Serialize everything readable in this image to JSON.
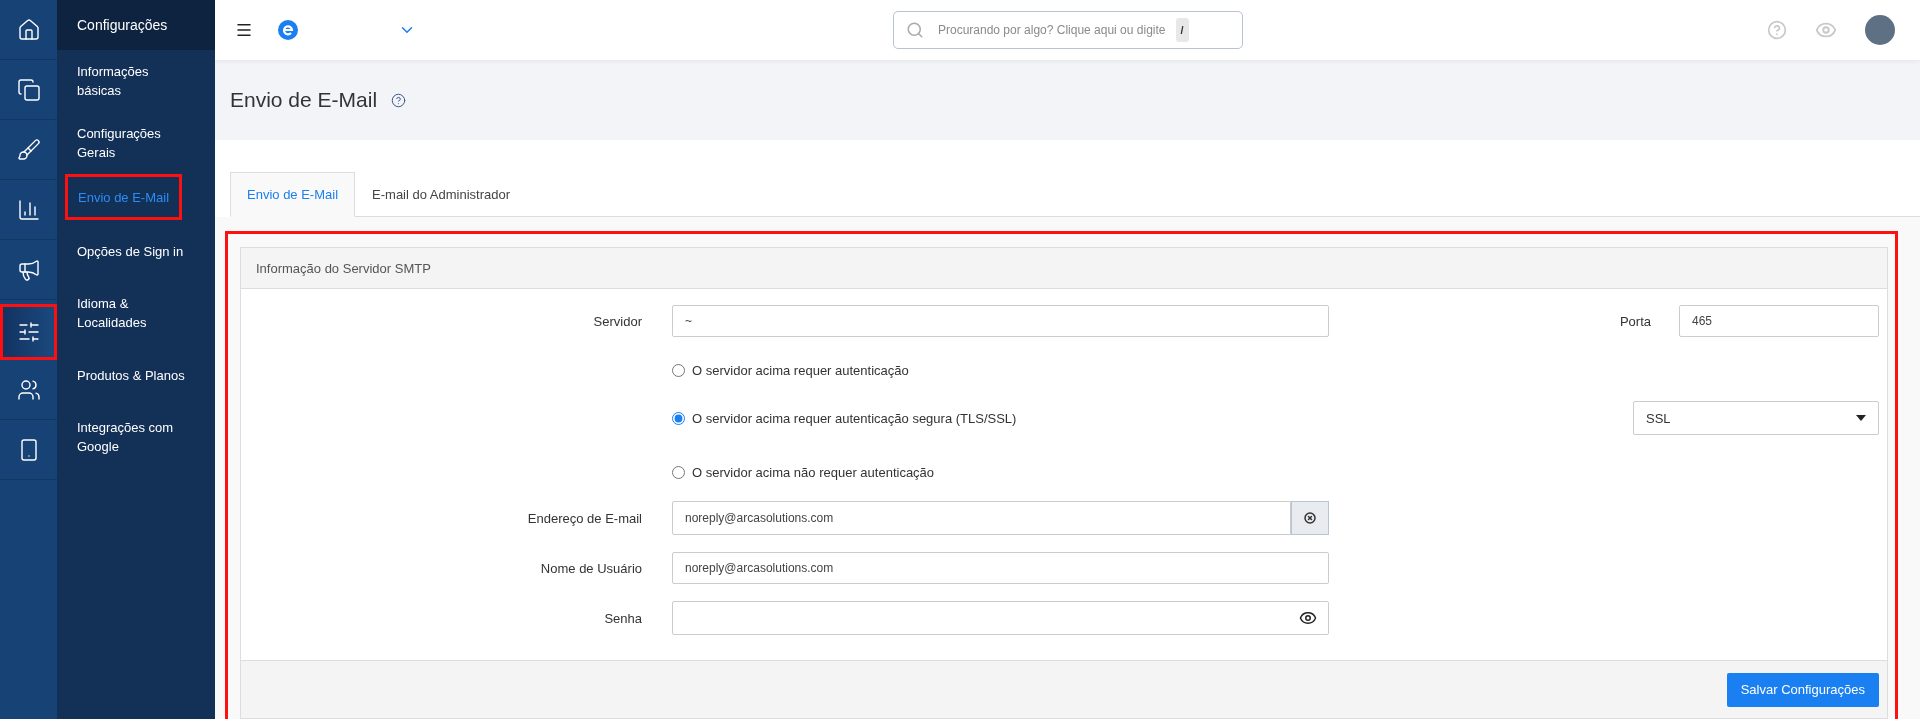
{
  "rail": [
    {
      "selected": false,
      "highlighted": false
    },
    {
      "selected": false,
      "highlighted": false
    },
    {
      "selected": false,
      "highlighted": false
    },
    {
      "selected": false,
      "highlighted": false
    },
    {
      "selected": false,
      "highlighted": false
    },
    {
      "selected": true,
      "highlighted": true
    },
    {
      "selected": false,
      "highlighted": false
    },
    {
      "selected": false,
      "highlighted": false
    }
  ],
  "sidebar": {
    "title": "Configurações",
    "items": [
      {
        "label": "Informações básicas",
        "selected": false,
        "highlighted": false
      },
      {
        "label": "Configurações Gerais",
        "selected": false,
        "highlighted": false
      },
      {
        "label": "Envio de E-Mail",
        "selected": true,
        "highlighted": true
      },
      {
        "label": "Opções de Sign in",
        "selected": false,
        "highlighted": false
      },
      {
        "label": "Idioma & Localidades",
        "selected": false,
        "highlighted": false
      },
      {
        "label": "Produtos & Planos",
        "selected": false,
        "highlighted": false
      },
      {
        "label": "Integrações com Google",
        "selected": false,
        "highlighted": false
      }
    ]
  },
  "topbar": {
    "search": {
      "placeholder": "Procurando por algo? Clique aqui ou digite",
      "shortcut": "/"
    }
  },
  "page": {
    "title": "Envio de E-Mail"
  },
  "tabs": [
    {
      "label": "Envio de E-Mail",
      "selected": true
    },
    {
      "label": "E-mail do Administrador",
      "selected": false
    }
  ],
  "panel": {
    "highlighted": true,
    "title": "Informação do Servidor SMTP",
    "server": {
      "label": "Servidor",
      "value": "~"
    },
    "port": {
      "label": "Porta",
      "value": "465"
    },
    "auth_options": [
      {
        "label": "O servidor acima requer autenticação",
        "selected": false
      },
      {
        "label": "O servidor acima requer autenticação segura (TLS/SSL)",
        "selected": true
      },
      {
        "label": "O servidor acima não requer autenticação",
        "selected": false
      }
    ],
    "encryption": {
      "value": "SSL"
    },
    "email": {
      "label": "Endereço de E-mail",
      "value": "noreply@arcasolutions.com"
    },
    "username": {
      "label": "Nome de Usuário",
      "value": "noreply@arcasolutions.com"
    },
    "password": {
      "label": "Senha"
    },
    "save_button": "Salvar Configurações"
  }
}
